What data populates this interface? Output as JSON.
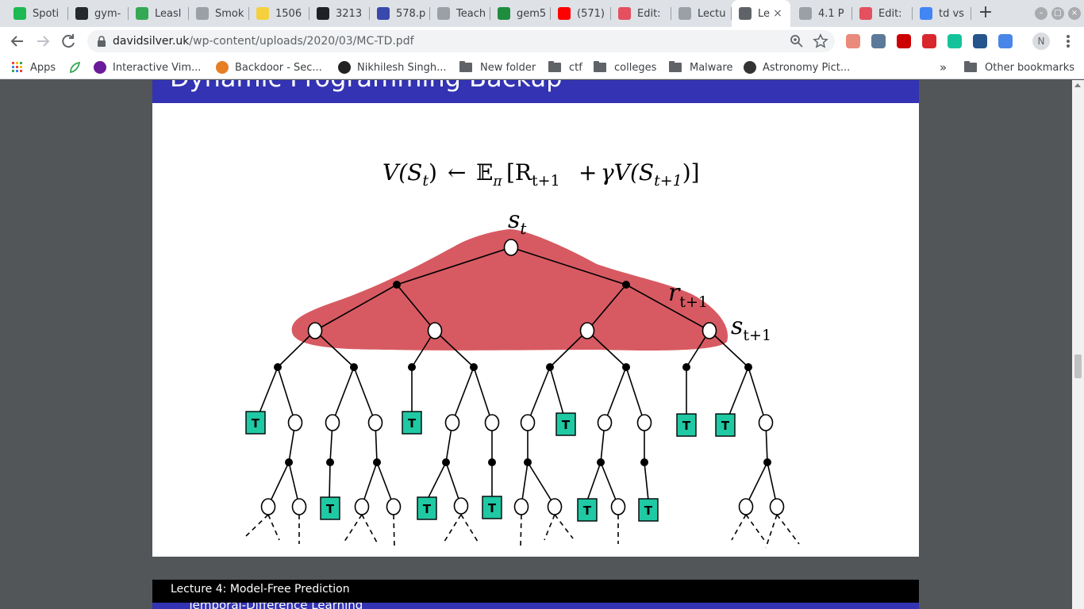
{
  "browser": {
    "tabs": [
      {
        "title": "Spoti",
        "icon": "spotify-icon",
        "color": "#1db954"
      },
      {
        "title": "gym-",
        "icon": "github-icon",
        "color": "#24292e"
      },
      {
        "title": "Leasl",
        "icon": "leaf-icon",
        "color": "#34a853"
      },
      {
        "title": "Smok",
        "icon": "globe-icon",
        "color": "#9aa0a6"
      },
      {
        "title": "1506",
        "icon": "smiley-icon",
        "color": "#f4d03f"
      },
      {
        "title": "3213",
        "icon": "gear-icon",
        "color": "#202124"
      },
      {
        "title": "578.p",
        "icon": "circle-icon",
        "color": "#3949ab"
      },
      {
        "title": "Teach",
        "icon": "globe-icon",
        "color": "#9aa0a6"
      },
      {
        "title": "gem5",
        "icon": "globe-icon",
        "color": "#1e8e3e"
      },
      {
        "title": "(571)",
        "icon": "youtube-icon",
        "color": "#ff0000"
      },
      {
        "title": "Edit:",
        "icon": "s-icon",
        "color": "#e4505e"
      },
      {
        "title": "Lectu",
        "icon": "globe-icon",
        "color": "#9aa0a6"
      },
      {
        "title": "Le",
        "icon": "globe-icon",
        "color": "#5f6368",
        "active": true
      },
      {
        "title": "4.1 P",
        "icon": "globe-icon",
        "color": "#9aa0a6"
      },
      {
        "title": "Edit:",
        "icon": "s-icon",
        "color": "#e4505e"
      },
      {
        "title": "td vs",
        "icon": "google-icon",
        "color": "#4285f4"
      }
    ],
    "new_tab": "+",
    "window_controls": [
      "–",
      "□",
      "×"
    ],
    "url_host": "davidsilver.uk",
    "url_path": "/wp-content/uploads/2020/03/MC-TD.pdf",
    "profile_initial": "N",
    "extensions": [
      {
        "icon": "blocker-icon",
        "color": "#ea8a7a"
      },
      {
        "icon": "app-icon",
        "color": "#5b7a99"
      },
      {
        "icon": "youtube-ext-icon",
        "color": "#cc0000"
      },
      {
        "icon": "mega-icon",
        "color": "#d9272e"
      },
      {
        "icon": "grammarly-icon",
        "color": "#15c39a"
      },
      {
        "icon": "eye-icon",
        "color": "#26548c"
      },
      {
        "icon": "reader-icon",
        "color": "#4a86e8"
      }
    ]
  },
  "bookmarks": {
    "items": [
      {
        "label": "Apps",
        "type": "apps"
      },
      {
        "label": "",
        "type": "leaf"
      },
      {
        "label": "Interactive Vim...",
        "type": "site",
        "color": "#6a1b9a"
      },
      {
        "label": "Backdoor - Sec...",
        "type": "site",
        "color": "#e67e22"
      },
      {
        "label": "Nikhilesh Singh...",
        "type": "site",
        "color": "#222222"
      },
      {
        "label": "New folder",
        "type": "folder"
      },
      {
        "label": "ctf",
        "type": "folder"
      },
      {
        "label": "colleges",
        "type": "folder"
      },
      {
        "label": "Malware",
        "type": "folder"
      },
      {
        "label": "Astronomy Pict...",
        "type": "site",
        "color": "#333333"
      }
    ],
    "overflow": "»",
    "other": "Other bookmarks"
  },
  "slide": {
    "title": "Dynamic Programming Backup",
    "equation": {
      "lhs": "V(S",
      "lhs_sub": "t",
      "lhs_close": ")",
      "arrow": "←",
      "expect": "𝔼",
      "expect_sub": "π",
      "bracket_open": "[R",
      "r_sub": "t+1",
      "plus": "+",
      "gamma": "γV(S",
      "s_sub": "t+1",
      "close": ")]"
    },
    "labels": {
      "st": "s",
      "st_sub": "t",
      "rt1": "r",
      "rt1_sub": "t+1",
      "st1": "s",
      "st1_sub": "t+1",
      "terminal": "T"
    },
    "colors": {
      "backup_region": "#d75a62",
      "terminal": "#1fc9a4",
      "title_bar": "#3333b3"
    }
  },
  "next_page": {
    "header": "Lecture 4: Model-Free Prediction",
    "subheader": "Temporal-Difference Learning"
  }
}
